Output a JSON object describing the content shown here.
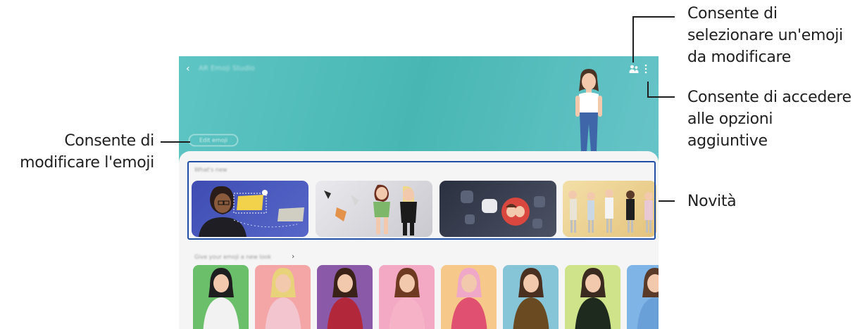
{
  "callouts": {
    "select_emoji": [
      "Consente di",
      "selezionare un'emoji",
      "da modificare"
    ],
    "more_options": [
      "Consente di accedere",
      "alle opzioni",
      "aggiuntive"
    ],
    "whats_new": "Novità",
    "edit_emoji": [
      "Consente di",
      "modificare l'emoji"
    ]
  },
  "screen": {
    "header_title": "AR Emoji Studio",
    "edit_button": "Edit emoji",
    "whats_new_title": "What's new",
    "looks_title": "Give your emoji a new look"
  },
  "icons": {
    "back": "back-arrow-icon",
    "people": "people-icon",
    "more": "more-options-icon",
    "chevron": "chevron-right-icon"
  },
  "colors": {
    "screen_bg": "#4fbcb8",
    "panel_bg": "#f5f5f5",
    "highlight": "#1f4fa7",
    "callout_text": "#1f1f1f"
  },
  "thumbnail_colors": [
    "#6bbf6b",
    "#f4a6a6",
    "#8a5aa8",
    "#f3a9c3",
    "#f6c98a",
    "#86c5d8",
    "#cfe38a",
    "#7fb5e6"
  ]
}
